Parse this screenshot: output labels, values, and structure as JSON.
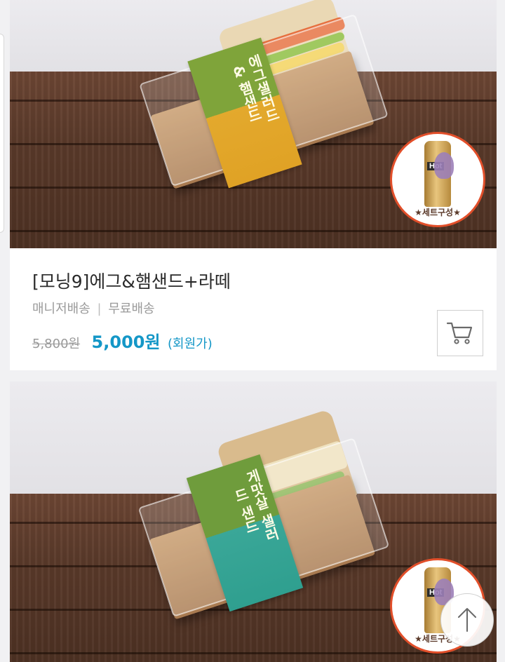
{
  "products": [
    {
      "title": "[모닝9]에그&햄샌드+라떼",
      "shipping_method": "매니저배송",
      "shipping_separator": "|",
      "shipping_fee": "무료배송",
      "original_price": "5,800원",
      "sale_price": "5,000원",
      "price_note": "(회원가)",
      "package_label": "에그샐러드 & 햄샌드",
      "set_badge": "★세트구성★",
      "drink_label": "Hot"
    },
    {
      "package_label": "게맛살 샐러드 샌드",
      "set_badge": "★세트구성★",
      "drink_label": "Hot"
    }
  ],
  "icons": {
    "cart": "shopping-cart-icon",
    "scroll_top": "arrow-up-icon"
  },
  "colors": {
    "price_accent": "#1497c7",
    "background": "#f1f1f3",
    "badge_border": "#e24f2a"
  }
}
